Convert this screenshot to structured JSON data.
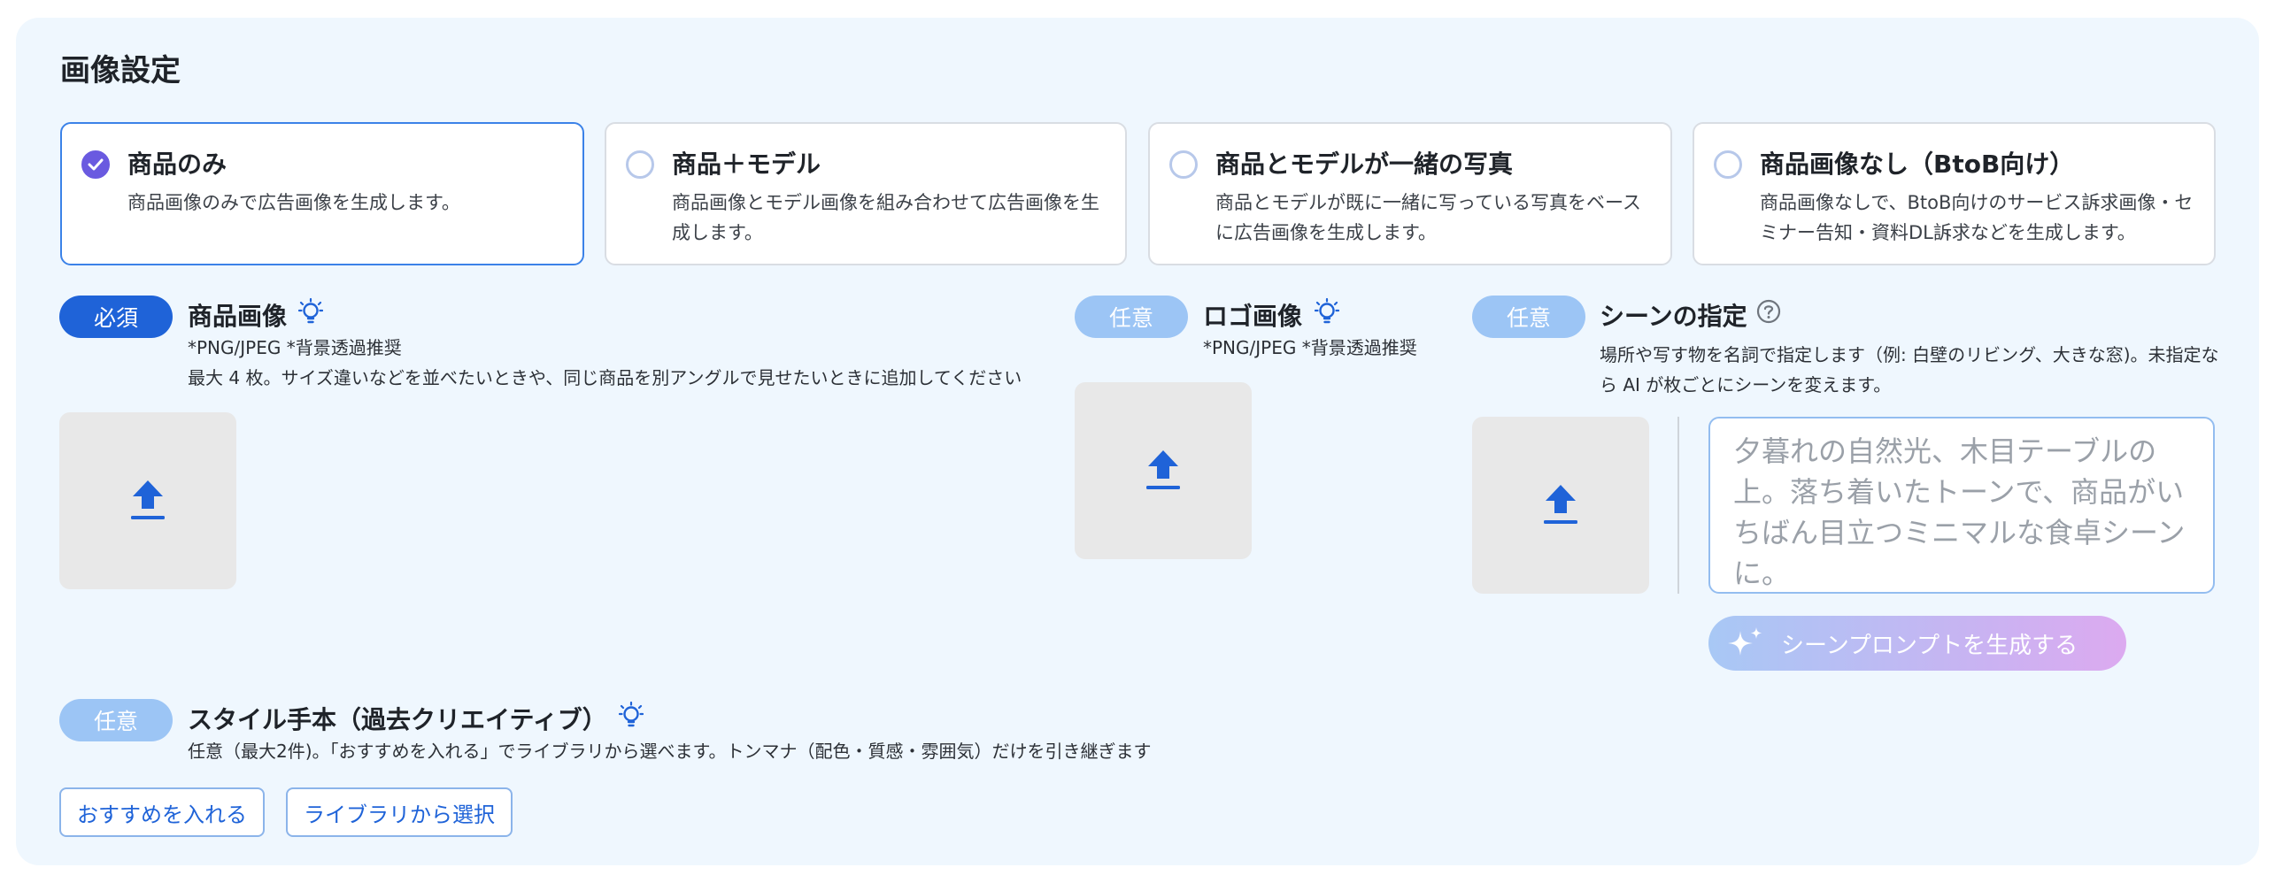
{
  "page": {
    "title": "画像設定"
  },
  "options": [
    {
      "title": "商品のみ",
      "desc": "商品画像のみで広告画像を生成します。",
      "selected": true
    },
    {
      "title": "商品＋モデル",
      "desc": "商品画像とモデル画像を組み合わせて広告画像を生成します。",
      "selected": false
    },
    {
      "title": "商品とモデルが一緒の写真",
      "desc": "商品とモデルが既に一緒に写っている写真をベースに広告画像を生成します。",
      "selected": false
    },
    {
      "title": "商品画像なし（BtoB向け）",
      "desc": "商品画像なしで、BtoB向けのサービス訴求画像・セミナー告知・資料DL訴求などを生成します。",
      "selected": false
    }
  ],
  "product_image": {
    "badge": "必須",
    "title": "商品画像",
    "format": "*PNG/JPEG *背景透過推奨",
    "note": "最大 4 枚。サイズ違いなどを並べたいときや、同じ商品を別アングルで見せたいときに追加してください"
  },
  "logo_image": {
    "badge": "任意",
    "title": "ロゴ画像",
    "format": "*PNG/JPEG *背景透過推奨"
  },
  "scene": {
    "badge": "任意",
    "title": "シーンの指定",
    "note": "場所や写す物を名詞で指定します（例: 白壁のリビング、大きな窓)。未指定なら AI が枚ごとにシーンを変えます。",
    "placeholder": "夕暮れの自然光、木目テーブルの上。落ち着いたトーンで、商品がいちばん目立つミニマルな食卓シーンに。",
    "generate_label": "シーンプロンプトを生成する"
  },
  "style": {
    "badge": "任意",
    "title": "スタイル手本（過去クリエイティブ）",
    "note": "任意（最大2件)。「おすすめを入れる」でライブラリから選べます。トンマナ（配色・質感・雰囲気）だけを引き継ぎます",
    "recommend_label": "おすすめを入れる",
    "library_label": "ライブラリから選択"
  },
  "colors": {
    "accent": "#1f63d8",
    "selected_radio": "#6a5ae0",
    "panel_bg": "#eff7fe"
  },
  "icons": {
    "tip": "lightbulb-icon",
    "help": "question-circle-icon",
    "upload": "upload-icon",
    "sparkle": "sparkle-icon"
  }
}
